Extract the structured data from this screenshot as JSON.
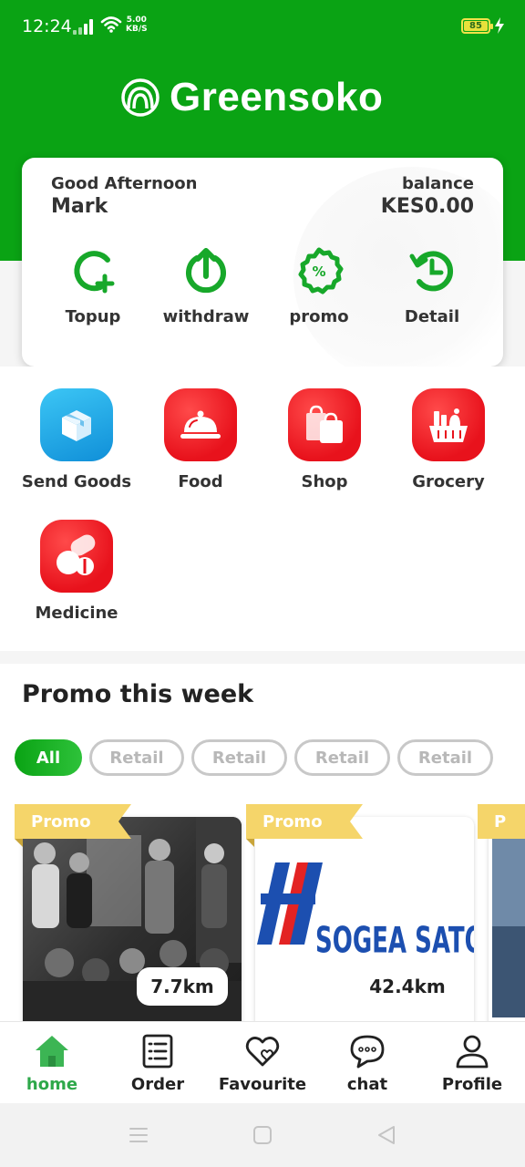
{
  "status_bar": {
    "time": "12:24",
    "net_speed_value": "5.00",
    "net_speed_unit": "KB/S",
    "battery": "85"
  },
  "app": {
    "name": "Greensoko"
  },
  "account": {
    "greeting": "Good Afternoon",
    "user_name": "Mark",
    "balance_label": "balance",
    "balance_value": "KES0.00"
  },
  "quick_actions": [
    {
      "label": "Topup",
      "icon": "topup-icon"
    },
    {
      "label": "withdraw",
      "icon": "withdraw-icon"
    },
    {
      "label": "promo",
      "icon": "promo-badge-icon"
    },
    {
      "label": "Detail",
      "icon": "history-icon"
    }
  ],
  "services": [
    {
      "label": "Send Goods",
      "icon": "package-icon",
      "color": "#1a9ee2"
    },
    {
      "label": "Food",
      "icon": "food-cloche-icon",
      "color": "#e8121c"
    },
    {
      "label": "Shop",
      "icon": "shopping-bags-icon",
      "color": "#e8121c"
    },
    {
      "label": "Grocery",
      "icon": "grocery-basket-icon",
      "color": "#e8121c"
    },
    {
      "label": "Medicine",
      "icon": "pills-icon",
      "color": "#e8121c"
    }
  ],
  "promo": {
    "title": "Promo this week",
    "filters": [
      "All",
      "Retail",
      "Retail",
      "Retail",
      "Retail"
    ],
    "cards": [
      {
        "tag": "Promo",
        "distance": "7.7km"
      },
      {
        "tag": "Promo",
        "distance": "42.4km",
        "brand_text": "SOGEA SATOM"
      },
      {
        "tag": "P"
      }
    ]
  },
  "bottom_nav": [
    {
      "label": "home",
      "icon": "home-icon",
      "active": true
    },
    {
      "label": "Order",
      "icon": "order-list-icon"
    },
    {
      "label": "Favourite",
      "icon": "heart-icon"
    },
    {
      "label": "chat",
      "icon": "chat-bubble-icon"
    },
    {
      "label": "Profile",
      "icon": "user-icon"
    }
  ],
  "colors": {
    "brand_green": "#0aa314",
    "service_red": "#e8121c",
    "service_blue": "#1a9ee2",
    "promo_tag": "#f5d56a",
    "active_nav": "#2ea84a"
  }
}
